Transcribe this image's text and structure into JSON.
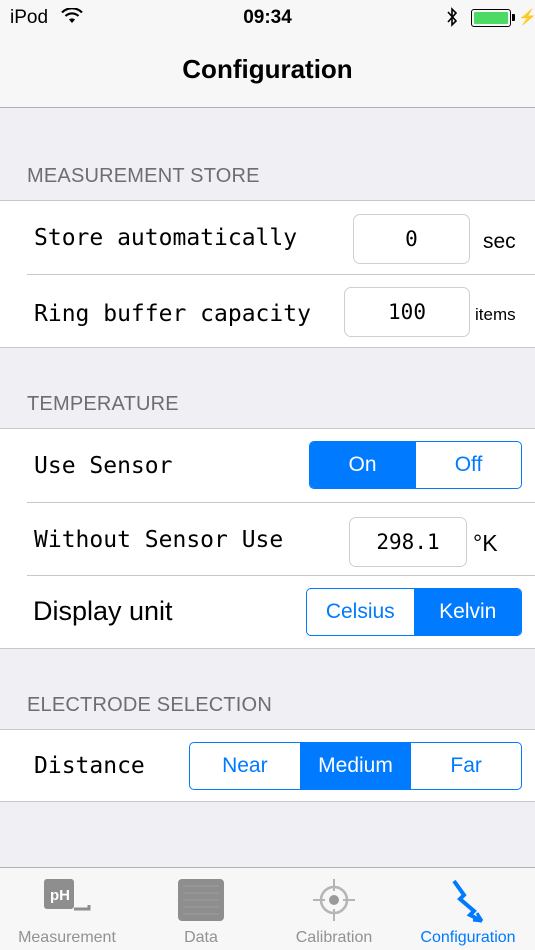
{
  "status": {
    "carrier": "iPod",
    "time": "09:34"
  },
  "nav": {
    "title": "Configuration"
  },
  "measurement_store": {
    "header": "MEASUREMENT STORE",
    "store_auto": {
      "label": "Store automatically",
      "value": "0",
      "unit": "sec"
    },
    "ring_buffer": {
      "label": "Ring buffer capacity",
      "value": "100",
      "unit": "items"
    }
  },
  "temperature": {
    "header": "TEMPERATURE",
    "use_sensor": {
      "label": "Use Sensor",
      "options": [
        "On",
        "Off"
      ],
      "selected": "On"
    },
    "without_sensor": {
      "label": "Without Sensor Use",
      "value": "298.1",
      "unit": "°K"
    },
    "display_unit": {
      "label": "Display unit",
      "options": [
        "Celsius",
        "Kelvin"
      ],
      "selected": "Kelvin"
    }
  },
  "electrode": {
    "header": "ELECTRODE SELECTION",
    "distance": {
      "label": "Distance",
      "options": [
        "Near",
        "Medium",
        "Far"
      ],
      "selected": "Medium"
    }
  },
  "tabs": [
    {
      "label": "Measurement",
      "icon": "ph-meter-icon",
      "active": false,
      "icon_text": "pH"
    },
    {
      "label": "Data",
      "icon": "data-grid-icon",
      "active": false
    },
    {
      "label": "Calibration",
      "icon": "crosshair-icon",
      "active": false
    },
    {
      "label": "Configuration",
      "icon": "lightning-icon",
      "active": true
    }
  ],
  "colors": {
    "accent": "#007aff",
    "battery": "#4cd964",
    "group_bg": "#efeff4"
  }
}
